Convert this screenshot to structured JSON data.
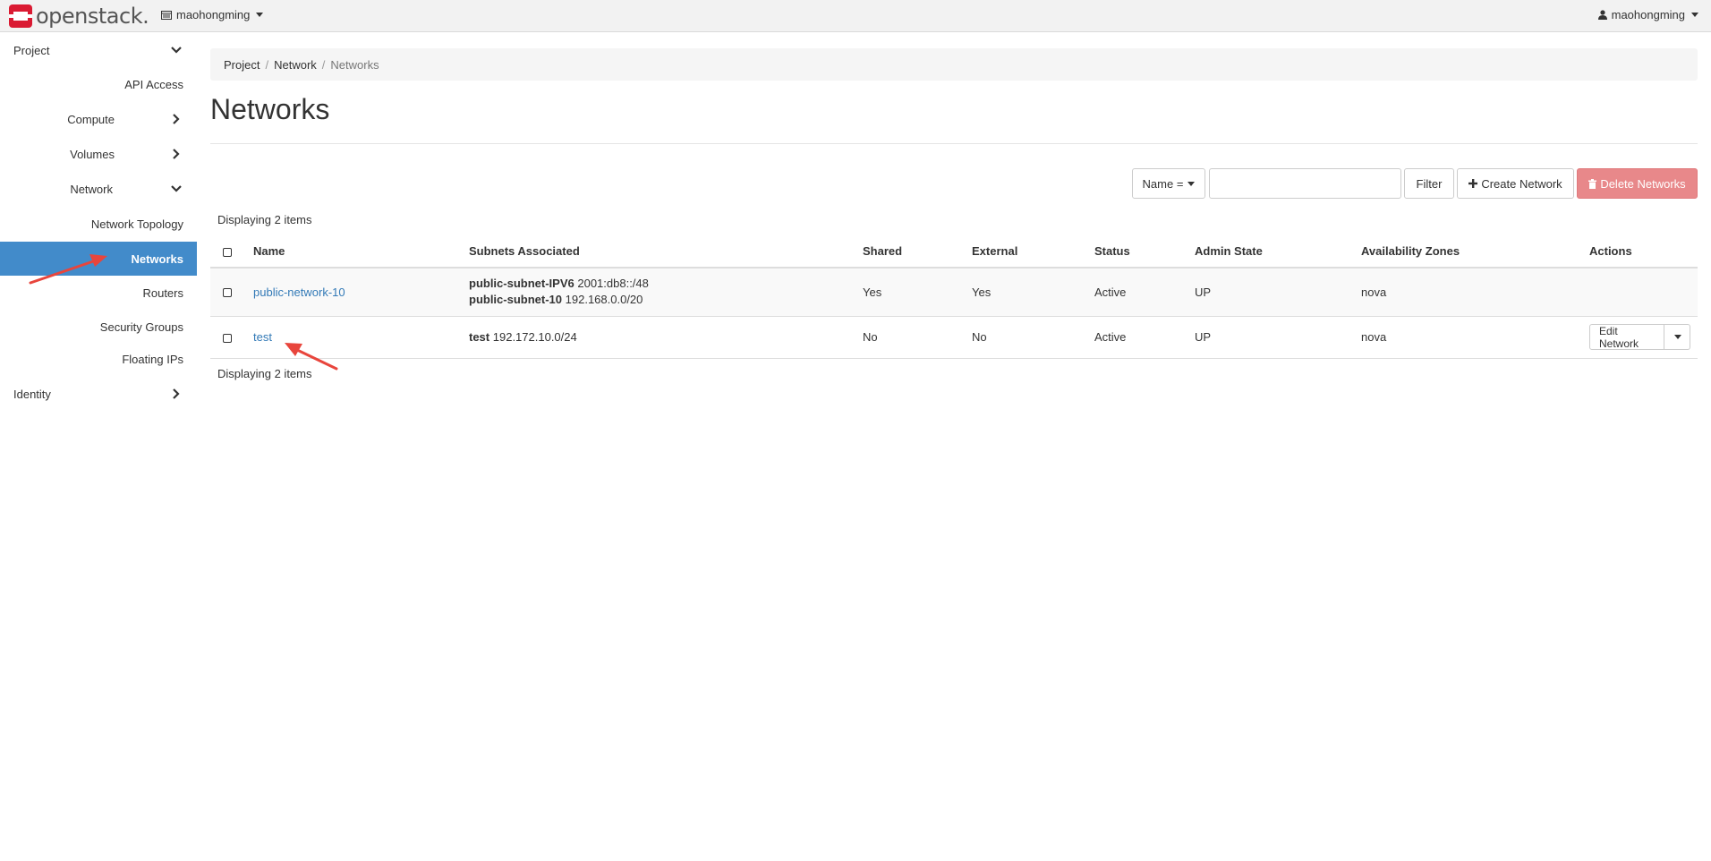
{
  "topbar": {
    "brand": "openstack.",
    "project": "maohongming",
    "user": "maohongming"
  },
  "sidebar": {
    "project": "Project",
    "api_access": "API Access",
    "compute": "Compute",
    "volumes": "Volumes",
    "network": "Network",
    "network_topology": "Network Topology",
    "networks": "Networks",
    "routers": "Routers",
    "security_groups": "Security Groups",
    "floating_ips": "Floating IPs",
    "identity": "Identity"
  },
  "breadcrumb": {
    "project": "Project",
    "network": "Network",
    "current": "Networks",
    "sep": "/"
  },
  "page": {
    "title": "Networks"
  },
  "toolbar": {
    "filter_field": "Name =",
    "filter_value": "",
    "filter_button": "Filter",
    "create_button": "Create Network",
    "delete_button": "Delete Networks"
  },
  "table": {
    "count_top": "Displaying 2 items",
    "count_bottom": "Displaying 2 items",
    "headers": {
      "name": "Name",
      "subnets": "Subnets Associated",
      "shared": "Shared",
      "external": "External",
      "status": "Status",
      "admin_state": "Admin State",
      "zones": "Availability Zones",
      "actions": "Actions"
    },
    "rows": [
      {
        "name": "public-network-10",
        "subnets": [
          {
            "name": "public-subnet-IPV6",
            "cidr": "2001:db8::/48"
          },
          {
            "name": "public-subnet-10",
            "cidr": "192.168.0.0/20"
          }
        ],
        "shared": "Yes",
        "external": "Yes",
        "status": "Active",
        "admin_state": "UP",
        "zones": "nova"
      },
      {
        "name": "test",
        "subnets": [
          {
            "name": "test",
            "cidr": "192.172.10.0/24"
          }
        ],
        "shared": "No",
        "external": "No",
        "status": "Active",
        "admin_state": "UP",
        "zones": "nova",
        "action": "Edit Network"
      }
    ]
  },
  "colors": {
    "accent": "#428bca",
    "link": "#337ab7",
    "danger": "#e8888a",
    "annotation_arrow": "#e8453c",
    "logo_red": "#da1a32"
  }
}
